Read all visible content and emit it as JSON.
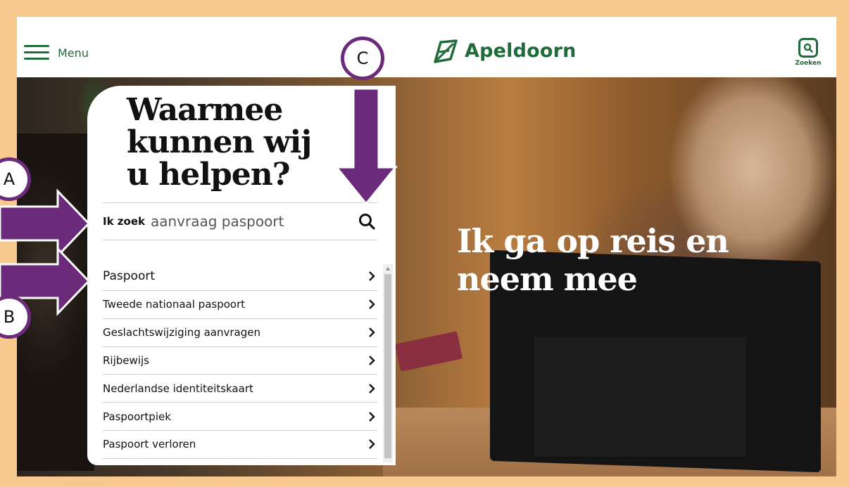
{
  "header": {
    "menu_label": "Menu",
    "logo_text": "Apeldoorn",
    "search_label": "Zoeken"
  },
  "panel": {
    "title_line1": "Waarmee",
    "title_line2": "kunnen wij",
    "title_line3": "u helpen?",
    "search_prefix": "Ik zoek",
    "search_value": "aanvraag paspoort"
  },
  "results": [
    {
      "label": "Paspoort"
    },
    {
      "label": "Tweede nationaal paspoort"
    },
    {
      "label": "Geslachtswijziging aanvragen"
    },
    {
      "label": "Rijbewijs"
    },
    {
      "label": "Nederlandse identiteitskaart"
    },
    {
      "label": "Paspoortpiek"
    },
    {
      "label": "Paspoort verloren"
    }
  ],
  "hero": {
    "title": "Ik ga op reis en neem mee"
  },
  "annotations": {
    "a": "A",
    "b": "B",
    "c": "C"
  },
  "colors": {
    "brand_green": "#1f6b3a",
    "annotation_purple": "#6b2a7a",
    "frame": "#f7c98f"
  }
}
